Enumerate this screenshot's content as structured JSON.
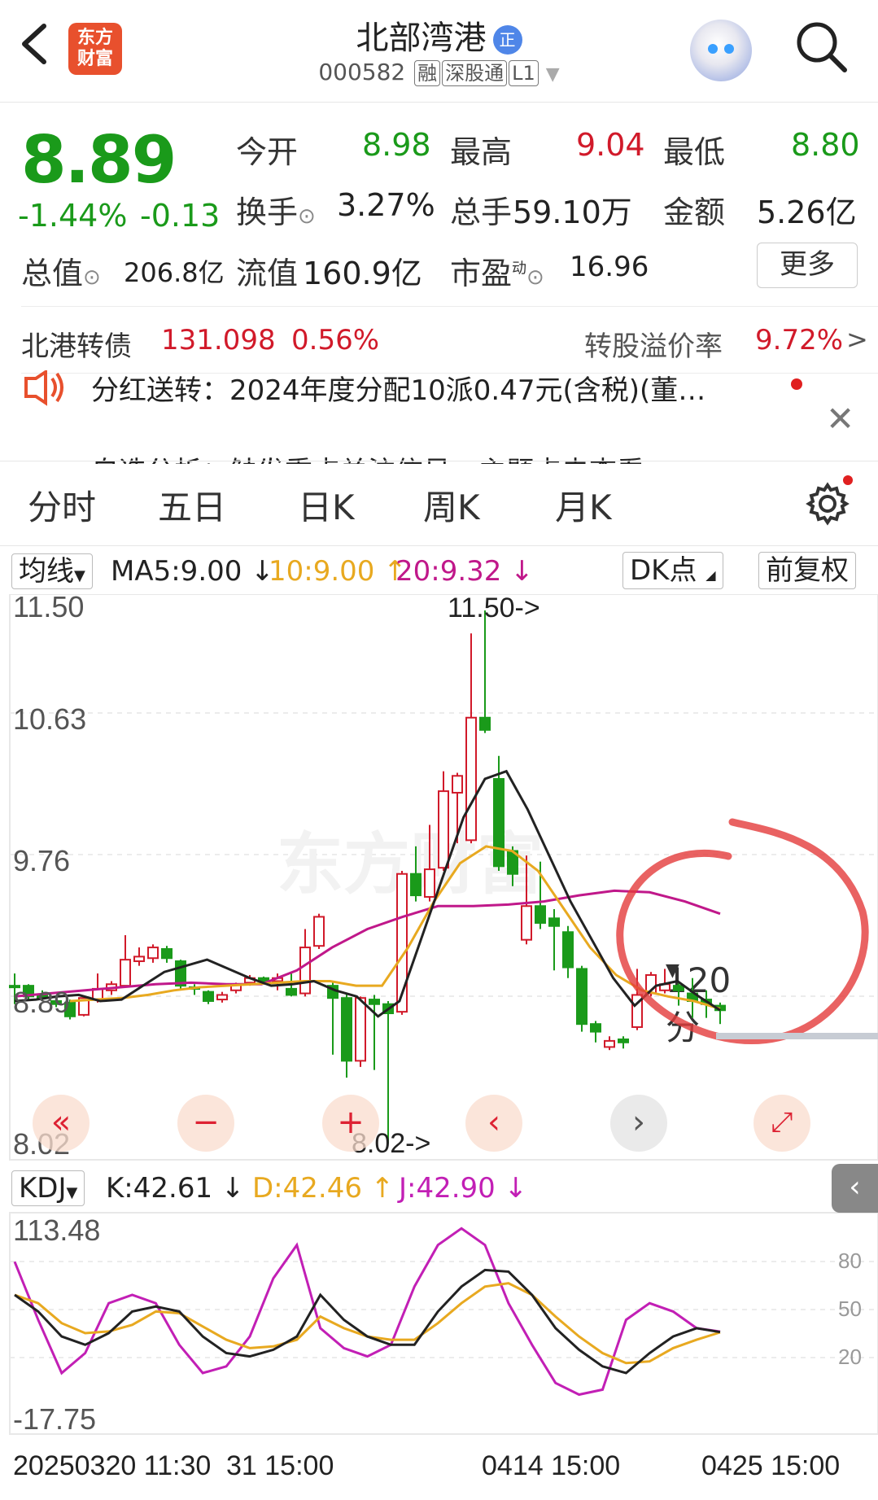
{
  "header": {
    "back_icon": "back-chevron-icon",
    "logo_line1": "东方",
    "logo_line2": "财富",
    "title": "北部湾港",
    "title_badge": "正",
    "code": "000582",
    "tags": [
      "融",
      "深股通",
      "L1"
    ]
  },
  "quote": {
    "price": "8.89",
    "change_pct": "-1.44%",
    "change": "-0.13",
    "open_label": "今开",
    "open": "8.98",
    "high_label": "最高",
    "high": "9.04",
    "low_label": "最低",
    "low": "8.80",
    "turnover_label": "换手",
    "turnover": "3.27%",
    "volume_label": "总手",
    "volume": "59.10万",
    "amount_label": "金额",
    "amount": "5.26亿",
    "mcap_label": "总值",
    "mcap": "206.8亿",
    "float_label": "流值",
    "float_cap": "160.9亿",
    "pe_label": "市盈",
    "pe_sup": "动",
    "pe": "16.96",
    "more_label": "更多"
  },
  "bond": {
    "name": "北港转债",
    "price": "131.098",
    "pct": "0.56%",
    "premium_label": "转股溢价率",
    "premium": "9.72%"
  },
  "notice": {
    "text": "分红送转：2024年度分配10派0.47元(含税)(董…",
    "text2": "自选分析：触发重点关注信号，主题点击查看"
  },
  "tabs": [
    "分时",
    "五日",
    "日K",
    "周K",
    "月K",
    "120分"
  ],
  "indicator": {
    "ma_select": "均线",
    "ma5": "MA5:9.00",
    "ma10": "10:9.00",
    "ma20": "20:9.32",
    "dk_label": "DK点",
    "adjust_label": "前复权"
  },
  "price_axis": [
    "11.50",
    "10.63",
    "9.76",
    "8.89",
    "8.02"
  ],
  "annotations": {
    "high": "11.50->",
    "low": "8.02->"
  },
  "kdj": {
    "select": "KDJ",
    "k": "K:42.61",
    "d": "D:42.46",
    "j": "J:42.90",
    "axis_top": "113.48",
    "axis_bottom": "-17.75",
    "levels": [
      "80",
      "50",
      "20"
    ]
  },
  "x_labels": [
    "20250320 11:30",
    "31 15:00",
    "0414 15:00",
    "0425 15:00"
  ],
  "watermark": "东方财富",
  "colors": {
    "up": "#d11a2a",
    "down": "#1a9a1a",
    "ma5": "#222222",
    "ma10": "#e8a920",
    "ma20": "#c0188a",
    "accent": "#e8502d"
  },
  "chart_data": {
    "type": "candlestick",
    "period": "120分",
    "ylim": [
      8.02,
      11.5
    ],
    "candles": [
      {
        "o": 9.05,
        "c": 9.04,
        "h": 9.13,
        "l": 8.93
      },
      {
        "o": 9.05,
        "c": 8.98,
        "h": 9.06,
        "l": 8.96
      },
      {
        "o": 8.99,
        "c": 8.97,
        "h": 9.02,
        "l": 8.95
      },
      {
        "o": 8.95,
        "c": 8.93,
        "h": 8.97,
        "l": 8.91
      },
      {
        "o": 8.94,
        "c": 8.85,
        "h": 8.96,
        "l": 8.83
      },
      {
        "o": 8.86,
        "c": 8.97,
        "h": 8.98,
        "l": 8.85
      },
      {
        "o": 8.96,
        "c": 9.03,
        "h": 9.13,
        "l": 8.94
      },
      {
        "o": 9.02,
        "c": 9.06,
        "h": 9.08,
        "l": 8.99
      },
      {
        "o": 9.05,
        "c": 9.22,
        "h": 9.38,
        "l": 9.04
      },
      {
        "o": 9.21,
        "c": 9.24,
        "h": 9.3,
        "l": 9.18
      },
      {
        "o": 9.23,
        "c": 9.3,
        "h": 9.32,
        "l": 9.2
      },
      {
        "o": 9.29,
        "c": 9.23,
        "h": 9.31,
        "l": 9.2
      },
      {
        "o": 9.21,
        "c": 9.05,
        "h": 9.22,
        "l": 9.02
      },
      {
        "o": 9.04,
        "c": 9.03,
        "h": 9.06,
        "l": 8.99
      },
      {
        "o": 9.01,
        "c": 8.95,
        "h": 9.02,
        "l": 8.93
      },
      {
        "o": 8.96,
        "c": 8.99,
        "h": 9.01,
        "l": 8.94
      },
      {
        "o": 9.02,
        "c": 9.06,
        "h": 9.07,
        "l": 9.0
      },
      {
        "o": 9.07,
        "c": 9.1,
        "h": 9.12,
        "l": 9.05
      },
      {
        "o": 9.1,
        "c": 9.08,
        "h": 9.11,
        "l": 9.06
      },
      {
        "o": 9.08,
        "c": 9.1,
        "h": 9.13,
        "l": 9.02
      },
      {
        "o": 9.03,
        "c": 8.99,
        "h": 9.14,
        "l": 8.98
      },
      {
        "o": 9.0,
        "c": 9.3,
        "h": 9.42,
        "l": 8.98
      },
      {
        "o": 9.31,
        "c": 9.5,
        "h": 9.52,
        "l": 9.29
      },
      {
        "o": 9.05,
        "c": 8.97,
        "h": 9.08,
        "l": 8.6
      },
      {
        "o": 8.97,
        "c": 8.56,
        "h": 9.0,
        "l": 8.45
      },
      {
        "o": 8.56,
        "c": 8.97,
        "h": 8.98,
        "l": 8.52
      },
      {
        "o": 8.96,
        "c": 8.93,
        "h": 8.99,
        "l": 8.5
      },
      {
        "o": 8.93,
        "c": 8.87,
        "h": 8.95,
        "l": 8.02
      },
      {
        "o": 8.88,
        "c": 9.78,
        "h": 9.8,
        "l": 8.86
      },
      {
        "o": 9.78,
        "c": 9.64,
        "h": 9.96,
        "l": 9.6
      },
      {
        "o": 9.63,
        "c": 9.81,
        "h": 10.1,
        "l": 9.6
      },
      {
        "o": 9.82,
        "c": 10.32,
        "h": 10.45,
        "l": 9.8
      },
      {
        "o": 10.31,
        "c": 10.42,
        "h": 10.44,
        "l": 9.98
      },
      {
        "o": 10.0,
        "c": 10.8,
        "h": 11.35,
        "l": 9.98
      },
      {
        "o": 10.8,
        "c": 10.72,
        "h": 11.5,
        "l": 10.7
      },
      {
        "o": 10.4,
        "c": 9.83,
        "h": 10.55,
        "l": 9.8
      },
      {
        "o": 9.93,
        "c": 9.78,
        "h": 9.96,
        "l": 9.7
      },
      {
        "o": 9.35,
        "c": 9.57,
        "h": 9.9,
        "l": 9.32
      },
      {
        "o": 9.57,
        "c": 9.46,
        "h": 9.86,
        "l": 9.42
      },
      {
        "o": 9.49,
        "c": 9.44,
        "h": 9.55,
        "l": 9.15
      },
      {
        "o": 9.4,
        "c": 9.17,
        "h": 9.44,
        "l": 9.1
      },
      {
        "o": 9.16,
        "c": 8.8,
        "h": 9.18,
        "l": 8.75
      },
      {
        "o": 8.8,
        "c": 8.75,
        "h": 8.82,
        "l": 8.68
      },
      {
        "o": 8.65,
        "c": 8.69,
        "h": 8.72,
        "l": 8.63
      },
      {
        "o": 8.7,
        "c": 8.68,
        "h": 8.72,
        "l": 8.64
      },
      {
        "o": 8.78,
        "c": 8.99,
        "h": 9.16,
        "l": 8.76
      },
      {
        "o": 9.0,
        "c": 9.12,
        "h": 9.14,
        "l": 8.98
      },
      {
        "o": 9.02,
        "c": 9.06,
        "h": 9.16,
        "l": 9.0
      },
      {
        "o": 9.05,
        "c": 9.02,
        "h": 9.07,
        "l": 8.92
      },
      {
        "o": 9.0,
        "c": 8.95,
        "h": 9.1,
        "l": 8.84
      },
      {
        "o": 8.96,
        "c": 8.93,
        "h": 9.02,
        "l": 8.84
      },
      {
        "o": 8.92,
        "c": 8.89,
        "h": 8.94,
        "l": 8.8
      }
    ],
    "ma5": [
      8.95,
      8.96,
      8.98,
      8.99,
      8.95,
      8.96,
      9.05,
      9.14,
      9.18,
      9.22,
      9.16,
      9.1,
      9.05,
      9.06,
      9.08,
      9.02,
      8.98,
      8.85,
      8.95,
      9.35,
      9.75,
      10.15,
      10.4,
      10.45,
      10.2,
      9.9,
      9.6,
      9.35,
      9.1,
      8.92,
      9.05,
      9.08,
      8.98,
      8.89
    ],
    "ma10": [
      8.95,
      8.96,
      8.97,
      8.99,
      9.02,
      9.04,
      9.05,
      9.06,
      9.07,
      9.08,
      9.08,
      9.05,
      9.05,
      9.3,
      9.6,
      9.85,
      9.96,
      9.93,
      9.8,
      9.55,
      9.3,
      9.12,
      9.02,
      8.98,
      8.95,
      8.9
    ],
    "ma20": [
      8.98,
      9.0,
      9.02,
      9.04,
      9.06,
      9.07,
      9.06,
      9.06,
      9.15,
      9.3,
      9.42,
      9.5,
      9.57,
      9.57,
      9.58,
      9.6,
      9.64,
      9.67,
      9.66,
      9.6,
      9.52
    ],
    "kdj_ylim": [
      -17.75,
      113.48
    ],
    "K": [
      65,
      55,
      40,
      35,
      42,
      55,
      58,
      55,
      40,
      30,
      28,
      32,
      40,
      65,
      50,
      40,
      35,
      35,
      55,
      70,
      80,
      79,
      65,
      45,
      32,
      22,
      18,
      30,
      40,
      45,
      42.61
    ],
    "D": [
      65,
      60,
      48,
      42,
      43,
      47,
      55,
      54,
      46,
      38,
      33,
      34,
      38,
      52,
      45,
      40,
      38,
      38,
      48,
      60,
      70,
      72,
      65,
      52,
      40,
      30,
      24,
      25,
      33,
      38,
      42.46
    ],
    "J": [
      85,
      50,
      18,
      30,
      60,
      65,
      60,
      35,
      18,
      22,
      40,
      75,
      95,
      45,
      33,
      28,
      35,
      70,
      95,
      105,
      95,
      60,
      35,
      12,
      5,
      8,
      50,
      60,
      55,
      45,
      42.9
    ]
  }
}
